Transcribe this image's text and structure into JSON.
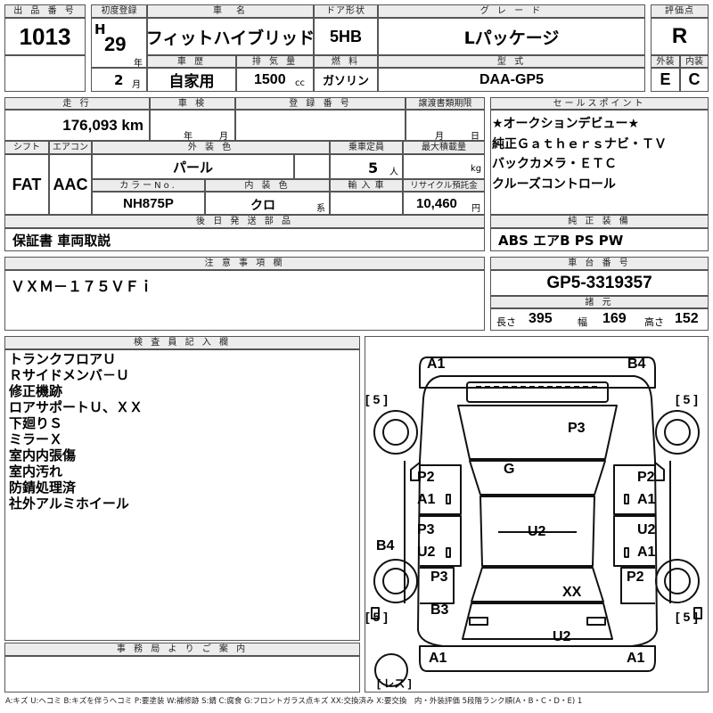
{
  "header": {
    "lot_no_label": "出 品 番 号",
    "lot_no": "1013",
    "first_reg_label": "初度登録",
    "era": "H",
    "year": "29",
    "year_unit": "年",
    "month": "2",
    "month_unit": "月",
    "car_name_label": "車　名",
    "car_name": "フィットハイブリッド",
    "door_label": "ドア形状",
    "door": "5HB",
    "grade_label": "グ レ ー ド",
    "grade": "Lパッケージ",
    "score_label": "評価点",
    "score": "R",
    "history_label": "車 歴",
    "history": "自家用",
    "displacement_label": "排 気 量",
    "displacement": "1500",
    "displacement_unit": "cc",
    "fuel_label": "燃 料",
    "fuel": "ガソリン",
    "model_label": "型 式",
    "model": "DAA-GP5",
    "exterior_label": "外装",
    "exterior": "E",
    "interior_label": "内装",
    "interior": "C"
  },
  "row2": {
    "mileage_label": "走 行",
    "mileage": "176,093 km",
    "inspection_label": "車 検",
    "insp_year_unit": "年",
    "insp_month_unit": "月",
    "reg_no_label": "登 録 番 号",
    "transfer_label": "譲渡書類期限",
    "transfer_month_unit": "月",
    "transfer_day_unit": "日",
    "shift_label": "シフト",
    "shift": "FAT",
    "aircon_label": "エアコン",
    "aircon": "AAC",
    "ext_color_label": "外 装 色",
    "ext_color": "パール",
    "capacity_label": "乗車定員",
    "capacity": "5",
    "capacity_unit": "人",
    "max_load_label": "最大積載量",
    "max_load_unit": "kg",
    "color_no_label": "カラーNo.",
    "color_no": "NH875P",
    "int_color_label": "内 装 色",
    "int_color": "クロ",
    "int_color_unit": "系",
    "import_label": "輸 入 車",
    "recycle_label": "リサイクル預託金",
    "recycle": "10,460",
    "recycle_unit": "円",
    "later_parts_label": "後 日 発 送 部 品",
    "later_parts": "保証書 車両取説"
  },
  "sales_point": {
    "label": "セールスポイント",
    "lines": [
      "★オークションデビュー★",
      "純正Ｇａｔｈｅｒｓナビ・ＴＶ",
      "バックカメラ・ＥＴＣ",
      "クルーズコントロール"
    ]
  },
  "genuine": {
    "label": "純 正 装 備",
    "value": "ABS エアB PS PW"
  },
  "caution": {
    "label": "注 意 事 項 欄",
    "value": "ＶＸＭ－１７５ＶＦｉ"
  },
  "chassis": {
    "label": "車 台 番 号",
    "value": "GP5-3319357",
    "dims_label": "諸 元",
    "length_label": "長さ",
    "length": "395",
    "width_label": "幅",
    "width": "169",
    "height_label": "高さ",
    "height": "152"
  },
  "inspector": {
    "label": "検 査 員 記 入 欄",
    "lines": [
      "トランクフロアＵ",
      "Ｒサイドメンバ－Ｕ",
      "修正機跡",
      "ロアサポートＵ、ＸＸ",
      "下廻りＳ",
      "ミラーＸ",
      "室内内張傷",
      "室内汚れ",
      "防錆処理済",
      "社外アルミホイール"
    ]
  },
  "office": {
    "label": "事 務 局 よ り ご 案 内"
  },
  "diagram": {
    "labels": {
      "a1_tl": "A1",
      "b4_tr": "B4",
      "tire_fl": "[ 5 ]",
      "tire_fr": "[ 5 ]",
      "p3_hood": "P3",
      "g_glass": "G",
      "p2_l1": "P2",
      "a1_l1": "A1",
      "p2_r1": "P2",
      "a1_r1": "A1",
      "b4_l": "B4",
      "p3_l2": "P3",
      "u2_l2": "U2",
      "u2_roof": "U2",
      "u2_r2": "U2",
      "a1_r2": "A1",
      "p3_l3": "P3",
      "p2_r3": "P2",
      "xx_rear": "XX",
      "tire_rl": "[ 5 ]",
      "tire_rr": "[ 5 ]",
      "b3_l": "B3",
      "u2_bottom": "U2",
      "a1_bl": "A1",
      "a1_br": "A1",
      "spare": "[ レス ]"
    }
  },
  "legend": "A:キズ U:ヘコミ B:キズを伴うヘコミ P:要塗装 W:補修跡 S:錆 C:腐食 G:フロントガラス点キズ XX:交換済み X:要交換　内・外装評価 5段階ランク順(A・B・C・D・E) 1"
}
